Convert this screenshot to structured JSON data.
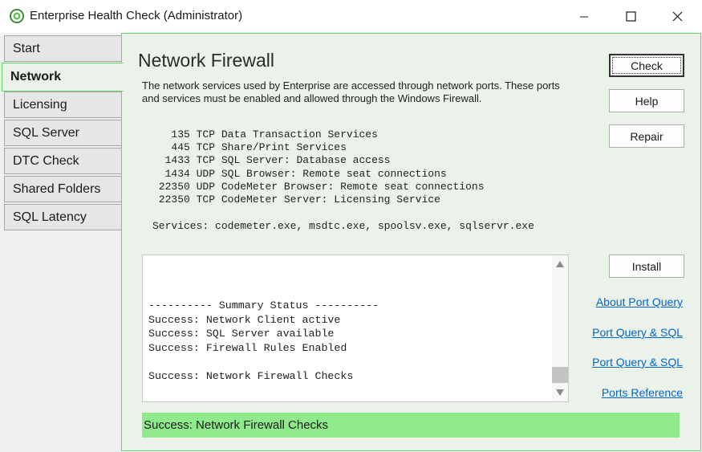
{
  "window": {
    "title": "Enterprise Health Check (Administrator)",
    "icon": "health-check-app-icon"
  },
  "tabs": [
    {
      "label": "Start",
      "active": false
    },
    {
      "label": "Network",
      "active": true
    },
    {
      "label": "Licensing",
      "active": false
    },
    {
      "label": "SQL Server",
      "active": false
    },
    {
      "label": "DTC Check",
      "active": false
    },
    {
      "label": "Shared Folders",
      "active": false
    },
    {
      "label": "SQL Latency",
      "active": false
    }
  ],
  "panel": {
    "heading": "Network Firewall",
    "description": "The network services used by Enterprise are accessed through network ports. These ports and services must be enabled and allowed through the Windows Firewall.",
    "ports": [
      {
        "port": "135",
        "protocol": "TCP",
        "service": "Data Transaction Services"
      },
      {
        "port": "445",
        "protocol": "TCP",
        "service": "Share/Print Services"
      },
      {
        "port": "1433",
        "protocol": "TCP",
        "service": "SQL Server: Database access"
      },
      {
        "port": "1434",
        "protocol": "UDP",
        "service": "SQL Browser: Remote seat connections"
      },
      {
        "port": "22350",
        "protocol": "UDP",
        "service": "CodeMeter Browser: Remote seat connections"
      },
      {
        "port": "22350",
        "protocol": "TCP",
        "service": "CodeMeter Server: Licensing Service"
      }
    ],
    "services_line": "Services: codemeter.exe, msdtc.exe, spoolsv.exe, sqlservr.exe",
    "buttons": {
      "check": "Check",
      "help": "Help",
      "repair": "Repair",
      "install": "Install"
    },
    "log_lines": [
      "---------- Summary Status ----------",
      "Success: Network Client active",
      "Success: SQL Server available",
      "Success: Firewall Rules Enabled",
      "",
      "Success: Network Firewall Checks"
    ],
    "links": [
      "About Port Query",
      "Port Query & SQL",
      "Port Query & SQL",
      "Ports Reference"
    ],
    "status": "Success: Network Firewall Checks",
    "status_color": "#8fea8c",
    "accent_color": "#5fdc5f"
  }
}
